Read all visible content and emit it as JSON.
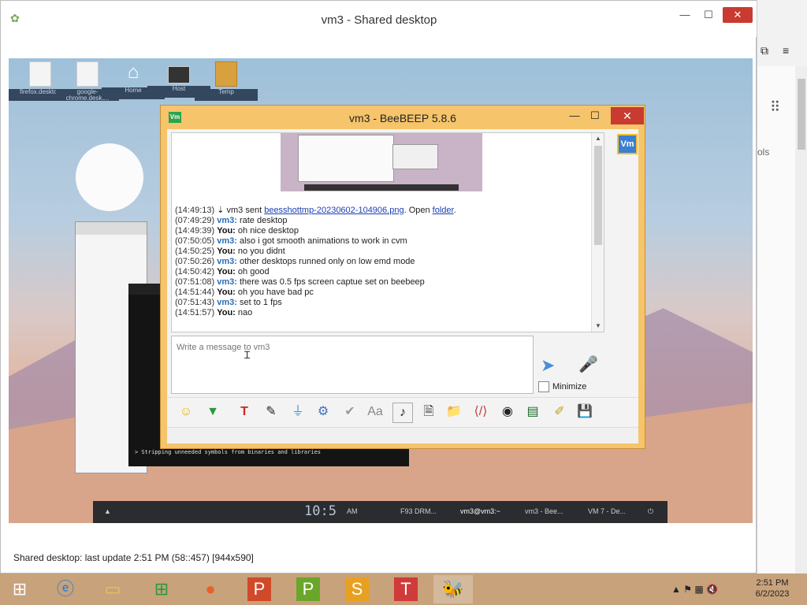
{
  "outer_window": {
    "title": "vm3 - Shared desktop",
    "min_glyph": "—",
    "max_glyph": "☐",
    "close_glyph": "✕",
    "status": "Shared desktop: last update 2:51 PM (58::457) [944x590]"
  },
  "right_panel": {
    "snippet": "ols"
  },
  "remote_desktop": {
    "icons": [
      {
        "label": "firefox.desktop"
      },
      {
        "label": "google-chrome.deskt..."
      },
      {
        "label": "Home"
      },
      {
        "label": "Host"
      },
      {
        "label": "Temp"
      }
    ],
    "terminal_line": "> Stripping unneeded symbols from binaries and libraries",
    "taskbar": {
      "clock": "10:5",
      "ampm": "AM",
      "items": [
        "F93 DRM...",
        "vm3@vm3:~",
        "vm3 - Bee...",
        "VM 7 - De..."
      ]
    }
  },
  "bee_window": {
    "title": "vm3 - BeeBEEP 5.8.6",
    "logo": "Vm",
    "min_glyph": "—",
    "max_glyph": "☐",
    "close_glyph": "✕",
    "chat": [
      {
        "time": "(14:49:13)",
        "file_prefix": "vm3 sent",
        "file": "beesshottmp-20230602-104906.png",
        "mid": ". Open",
        "link": "folder",
        "end": "."
      },
      {
        "time": "(07:49:29)",
        "who": "vm3:",
        "text": "rate desktop"
      },
      {
        "time": "(14:49:39)",
        "who": "You:",
        "text": "oh nice desktop"
      },
      {
        "time": "(07:50:05)",
        "who": "vm3:",
        "text": "also i got smooth animations to work in cvm"
      },
      {
        "time": "(14:50:25)",
        "who": "You:",
        "text": "no you didnt"
      },
      {
        "time": "(07:50:26)",
        "who": "vm3:",
        "text": "other desktops runned only on low emd mode"
      },
      {
        "time": "(14:50:42)",
        "who": "You:",
        "text": "oh good"
      },
      {
        "time": "(07:51:08)",
        "who": "vm3:",
        "text": "there was 0.5 fps screen captue set on beebeep"
      },
      {
        "time": "(14:51:44)",
        "who": "You:",
        "text": "oh you have bad pc"
      },
      {
        "time": "(07:51:43)",
        "who": "vm3:",
        "text": "set to 1 fps"
      },
      {
        "time": "(14:51:57)",
        "who": "You:",
        "text": "nao"
      }
    ],
    "message_placeholder": "Write a message to vm3",
    "minimize_label": "Minimize",
    "avatar": "Vm"
  },
  "taskbar": {
    "time": "2:51 PM",
    "date": "6/2/2023"
  }
}
